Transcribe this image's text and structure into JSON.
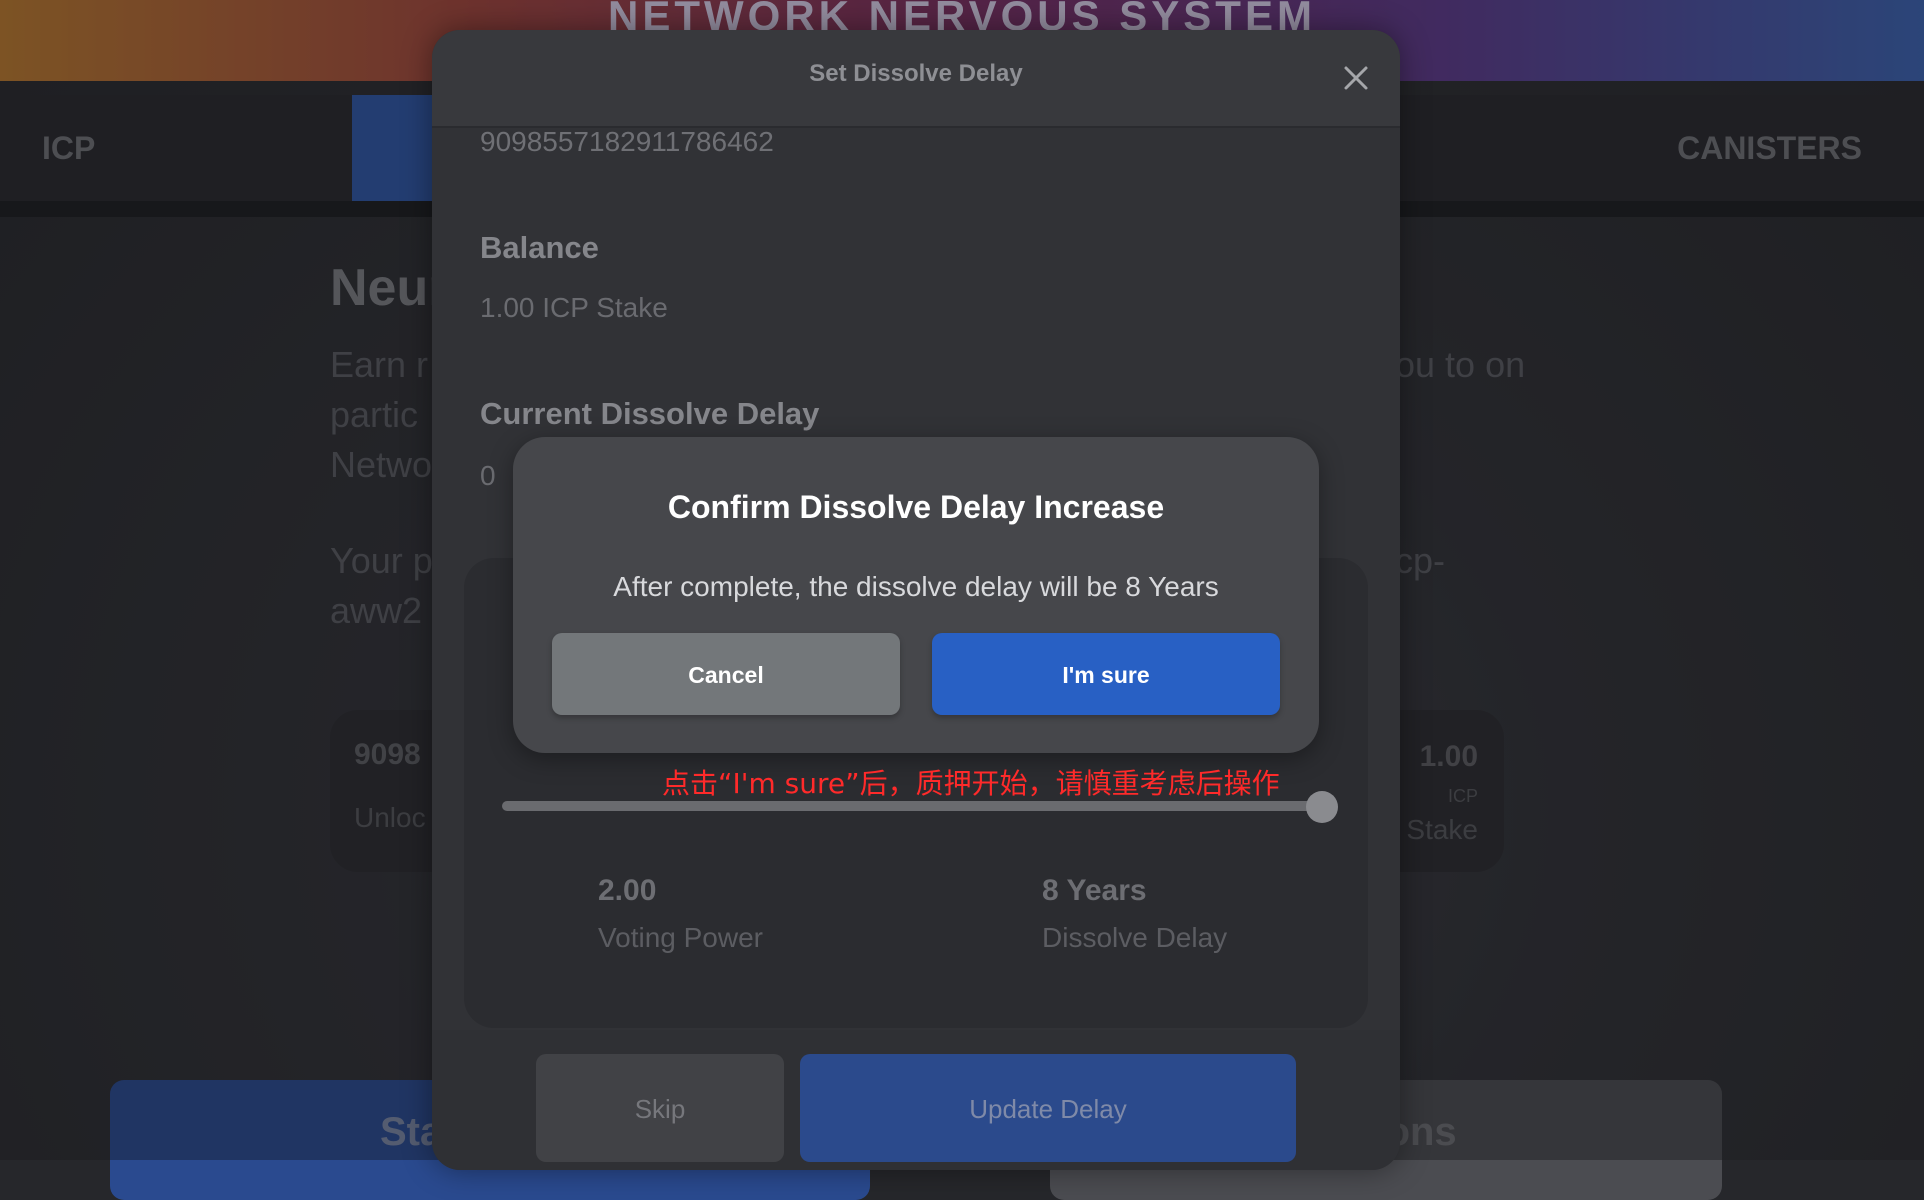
{
  "background": {
    "banner_title": "NETWORK NERVOUS SYSTEM",
    "tabs": [
      {
        "label": "ICP"
      },
      {
        "label": ""
      },
      {
        "label": "CANISTERS"
      }
    ],
    "page_title_fragment": "Neur",
    "description_left": "Earn r partic Netwo",
    "description_right": "ou to on",
    "principal_left": "Your p aww2",
    "principal_right": "cp-",
    "neuron_card": {
      "id_fragment": "9098",
      "status_fragment": "Unloc",
      "stake": "1.00",
      "currency": "ICP",
      "stake_label": "Stake"
    },
    "stake_button_fragment": "Sta",
    "merge_button_fragment": "rons"
  },
  "modal": {
    "title": "Set Dissolve Delay",
    "neuron_id": "9098557182911786462",
    "balance_label": "Balance",
    "balance_value": "1.00 ICP Stake",
    "current_delay_label": "Current Dissolve Delay",
    "current_delay_value": "0",
    "slider": {
      "value_fraction": 1.0
    },
    "voting_power_value": "2.00",
    "voting_power_label": "Voting Power",
    "dissolve_delay_value": "8 Years",
    "dissolve_delay_label": "Dissolve Delay",
    "skip_label": "Skip",
    "update_label": "Update Delay"
  },
  "confirm": {
    "title": "Confirm Dissolve Delay Increase",
    "message": "After complete, the dissolve delay will be 8 Years",
    "cancel_label": "Cancel",
    "confirm_label": "I'm sure"
  },
  "annotation": {
    "text": "点击“I'm sure”后，质押开始，请慎重考虑后操作",
    "color": "#ff2a2a"
  },
  "icons": {
    "close": "close-icon"
  }
}
